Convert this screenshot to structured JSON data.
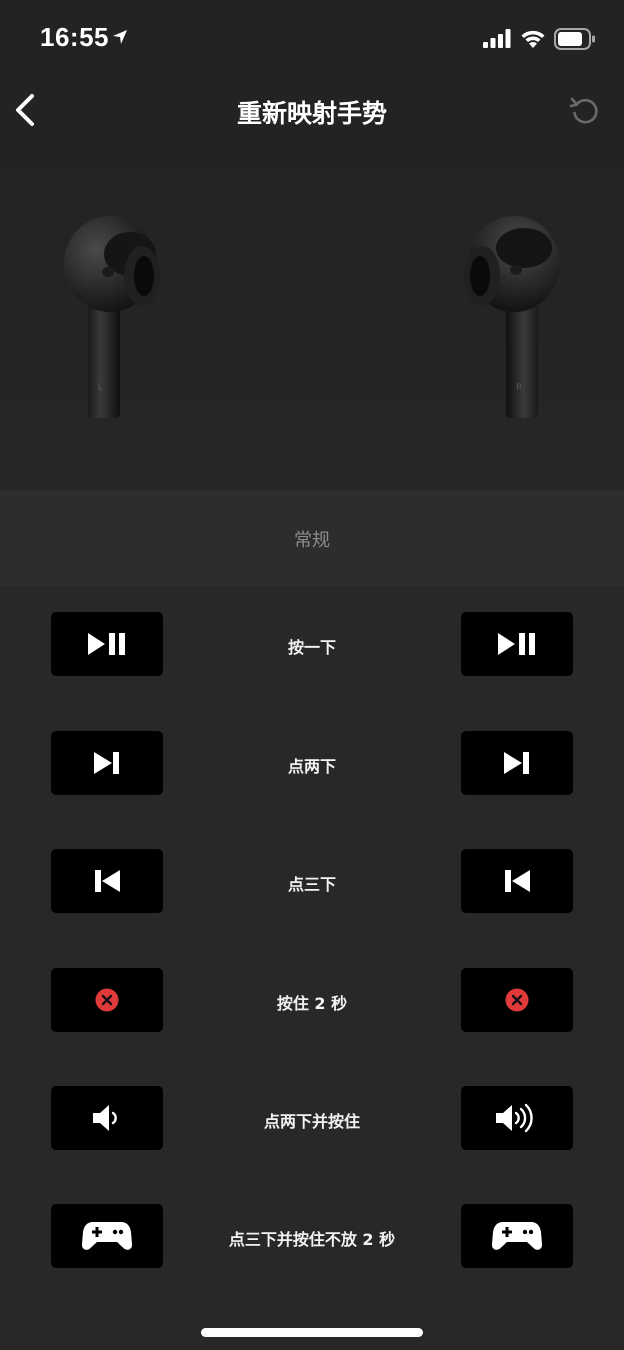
{
  "status_bar": {
    "time": "16:55"
  },
  "nav": {
    "title": "重新映射手势"
  },
  "section": {
    "label": "常规"
  },
  "gestures": [
    {
      "label": "按一下",
      "left_action": "play-pause-icon",
      "right_action": "play-pause-icon"
    },
    {
      "label": "点两下",
      "left_action": "next-track-icon",
      "right_action": "next-track-icon"
    },
    {
      "label": "点三下",
      "left_action": "previous-track-icon",
      "right_action": "previous-track-icon"
    },
    {
      "label": "按住 2 秒",
      "left_action": "disabled-x-icon",
      "right_action": "disabled-x-icon"
    },
    {
      "label": "点两下并按住",
      "left_action": "volume-down-icon",
      "right_action": "volume-up-icon"
    },
    {
      "label": "点三下并按住不放 2 秒",
      "left_action": "gamepad-icon",
      "right_action": "gamepad-icon"
    }
  ],
  "colors": {
    "background": "#232323",
    "button": "#000000",
    "disabled_red": "#e03a3a"
  }
}
